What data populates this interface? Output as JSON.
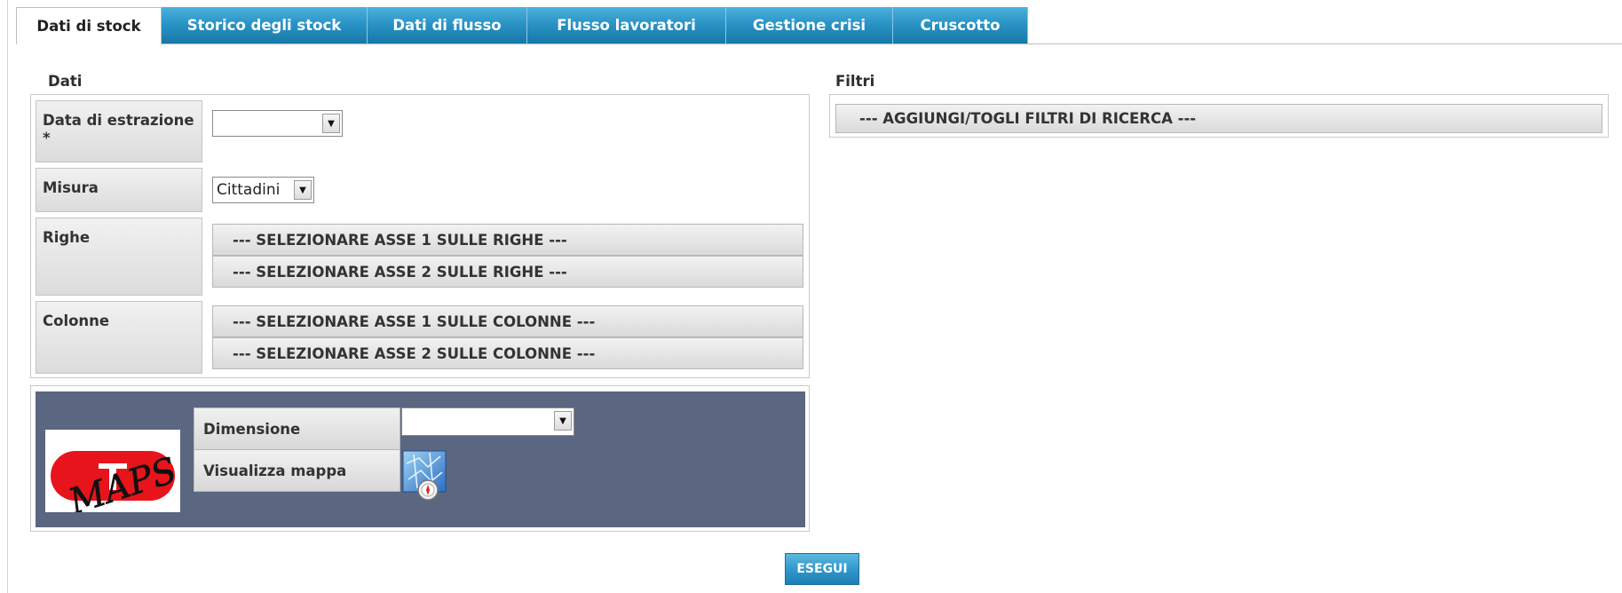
{
  "tabs": [
    {
      "label": "Dati di stock",
      "active": true
    },
    {
      "label": "Storico degli stock",
      "active": false
    },
    {
      "label": "Dati di flusso",
      "active": false
    },
    {
      "label": "Flusso lavoratori",
      "active": false
    },
    {
      "label": "Gestione crisi",
      "active": false
    },
    {
      "label": "Cruscotto",
      "active": false
    }
  ],
  "dati": {
    "title": "Dati",
    "data_estrazione": {
      "label_line1": "Data di estrazione",
      "label_line2": "*",
      "value": ""
    },
    "misura": {
      "label": "Misura",
      "value": "Cittadini"
    },
    "righe": {
      "label": "Righe",
      "asse1": "--- SELEZIONARE ASSE 1 SULLE RIGHE ---",
      "asse2": "--- SELEZIONARE ASSE 2 SULLE RIGHE ---"
    },
    "colonne": {
      "label": "Colonne",
      "asse1": "--- SELEZIONARE ASSE 1 SULLE COLONNE ---",
      "asse2": "--- SELEZIONARE ASSE 2 SULLE COLONNE ---"
    }
  },
  "maps": {
    "logo_text": "MAPS",
    "dimensione": {
      "label": "Dimensione",
      "value": ""
    },
    "visualizza": {
      "label": "Visualizza mappa"
    }
  },
  "filtri": {
    "title": "Filtri",
    "button": "--- AGGIUNGI/TOGLI FILTRI DI RICERCA ---"
  },
  "actions": {
    "esegui": "ESEGUI"
  },
  "colors": {
    "tab_blue": "#2a94c6",
    "maps_panel": "#5b6680",
    "logo_red": "#e8141c"
  }
}
